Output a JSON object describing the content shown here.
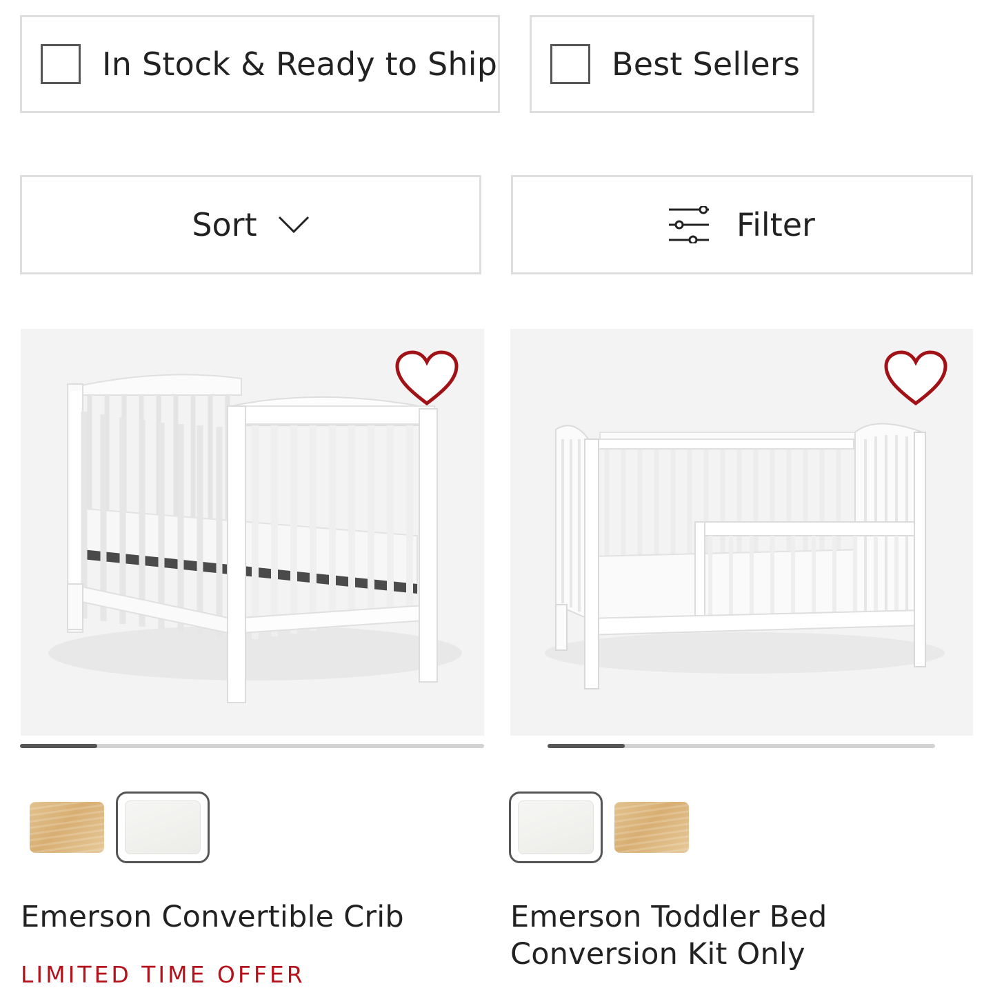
{
  "quick_filters": {
    "in_stock_label": "In Stock & Ready to Ship",
    "in_stock_checked": false,
    "best_sellers_label": "Best Sellers",
    "best_sellers_checked": false
  },
  "controls": {
    "sort_label": "Sort",
    "sort_icon": "chevron-down-icon",
    "filter_label": "Filter",
    "filter_icon": "sliders-icon"
  },
  "products": [
    {
      "title": "Emerson Convertible Crib",
      "badge": "LIMITED TIME OFFER",
      "favorite_icon": "heart-icon",
      "gallery_progress": 0.167,
      "swatches": [
        {
          "name": "oak",
          "color": "#d9b27a",
          "selected": false
        },
        {
          "name": "white",
          "color": "#f2f2f0",
          "selected": true
        }
      ]
    },
    {
      "title": "Emerson Toddler Bed Conversion Kit Only",
      "favorite_icon": "heart-icon",
      "gallery_progress": 0.2,
      "swatches": [
        {
          "name": "white",
          "color": "#f2f2f0",
          "selected": true
        },
        {
          "name": "oak",
          "color": "#d9b27a",
          "selected": false
        }
      ]
    }
  ],
  "colors": {
    "accent_red": "#b5121b",
    "heart_outline": "#a11217",
    "border": "#dedede",
    "text": "#222222"
  }
}
